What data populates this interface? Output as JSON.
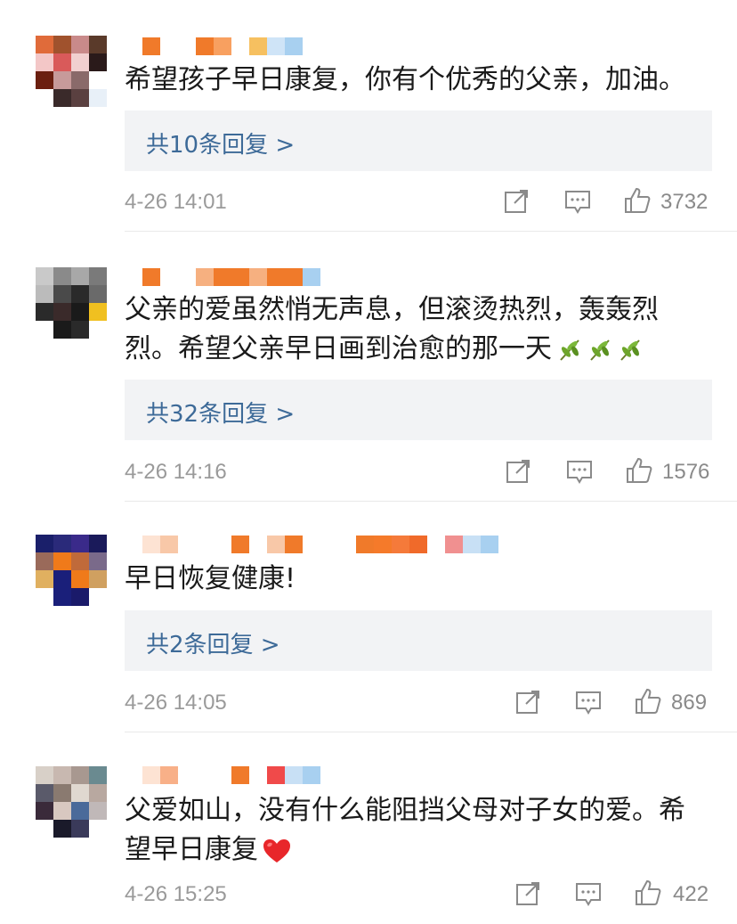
{
  "comments": [
    {
      "text": "希望孩子早日康复，你有个优秀的父亲，加油。",
      "replies_label": "共10条回复 >",
      "time": "4-26 14:01",
      "likes": "3732"
    },
    {
      "text": "父亲的爱虽然悄无声息，但滚烫热烈，轰轰烈烈。希望父亲早日画到治愈的那一天",
      "emoji": [
        "olive-branch",
        "olive-branch",
        "olive-branch"
      ],
      "replies_label": "共32条回复 >",
      "time": "4-26 14:16",
      "likes": "1576"
    },
    {
      "text": "早日恢复健康!",
      "replies_label": "共2条回复 >",
      "time": "4-26 14:05",
      "likes": "869"
    },
    {
      "text": "父爱如山，没有什么能阻挡父母对子女的爱。希望早日康复",
      "emoji": [
        "red-heart"
      ],
      "time": "4-26 15:25",
      "likes": "422"
    }
  ],
  "icons": {
    "share": "share-icon",
    "comment": "comment-icon",
    "like": "thumbs-up-icon"
  },
  "colors": {
    "reply_link": "#3d6a98",
    "reply_bg": "#f2f3f5",
    "meta_text": "#9a9a9a"
  }
}
